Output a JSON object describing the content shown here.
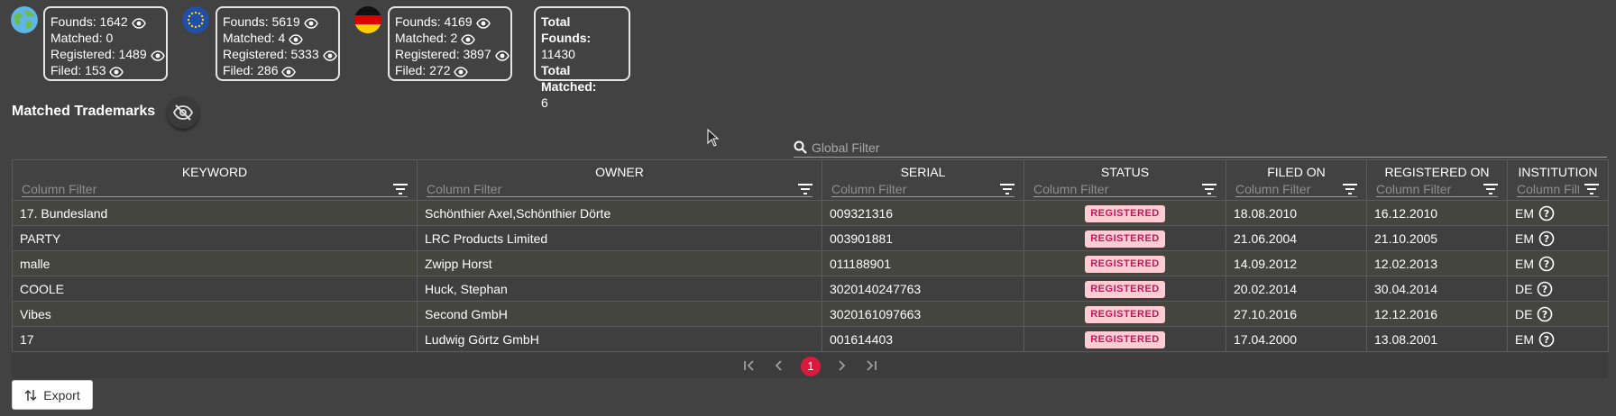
{
  "stats": [
    {
      "region": "world",
      "lines": [
        "Founds: 1642",
        "Matched: 0",
        "Registered: 1489",
        "Filed: 153"
      ],
      "eye": [
        true,
        false,
        true,
        true
      ]
    },
    {
      "region": "eu",
      "lines": [
        "Founds: 5619",
        "Matched: 4",
        "Registered: 5333",
        "Filed: 286"
      ],
      "eye": [
        true,
        true,
        true,
        true
      ]
    },
    {
      "region": "de",
      "lines": [
        "Founds: 4169",
        "Matched: 2",
        "Registered: 3897",
        "Filed: 272"
      ],
      "eye": [
        true,
        true,
        true,
        true
      ]
    }
  ],
  "totals": {
    "founds_label": "Total Founds:",
    "founds_value": "11430",
    "matched_label": "Total Matched:",
    "matched_value": "6"
  },
  "section": {
    "title": "Matched Trademarks",
    "toggle_icon": "eye-slash-icon"
  },
  "global_filter": {
    "placeholder": "Global Filter"
  },
  "table": {
    "columns": [
      "KEYWORD",
      "OWNER",
      "SERIAL",
      "STATUS",
      "FILED ON",
      "REGISTERED ON",
      "INSTITUTION"
    ],
    "filter_placeholder": "Column Filter",
    "rows": [
      {
        "keyword": "17. Bundesland",
        "owner": "Schönthier Axel,Schönthier Dörte",
        "serial": "009321316",
        "status": "REGISTERED",
        "filed": "18.08.2010",
        "registered": "16.12.2010",
        "institution": "EM"
      },
      {
        "keyword": "PARTY",
        "owner": "LRC Products Limited",
        "serial": "003901881",
        "status": "REGISTERED",
        "filed": "21.06.2004",
        "registered": "21.10.2005",
        "institution": "EM"
      },
      {
        "keyword": "malle",
        "owner": "Zwipp Horst",
        "serial": "011188901",
        "status": "REGISTERED",
        "filed": "14.09.2012",
        "registered": "12.02.2013",
        "institution": "EM"
      },
      {
        "keyword": "COOLE",
        "owner": "Huck, Stephan",
        "serial": "3020140247763",
        "status": "REGISTERED",
        "filed": "20.02.2014",
        "registered": "30.04.2014",
        "institution": "DE"
      },
      {
        "keyword": "Vibes",
        "owner": "Second GmbH",
        "serial": "3020161097663",
        "status": "REGISTERED",
        "filed": "27.10.2016",
        "registered": "12.12.2016",
        "institution": "DE"
      },
      {
        "keyword": "17",
        "owner": "Ludwig Görtz GmbH",
        "serial": "001614403",
        "status": "REGISTERED",
        "filed": "17.04.2000",
        "registered": "13.08.2001",
        "institution": "EM"
      }
    ]
  },
  "paginator": {
    "current_page": "1"
  },
  "export": {
    "label": "Export"
  },
  "colors": {
    "background": "#424242",
    "accent": "#d81b3c",
    "serial_text": "#c41e2a",
    "badge_bg": "#fecdd3",
    "badge_text": "#c2185b"
  }
}
